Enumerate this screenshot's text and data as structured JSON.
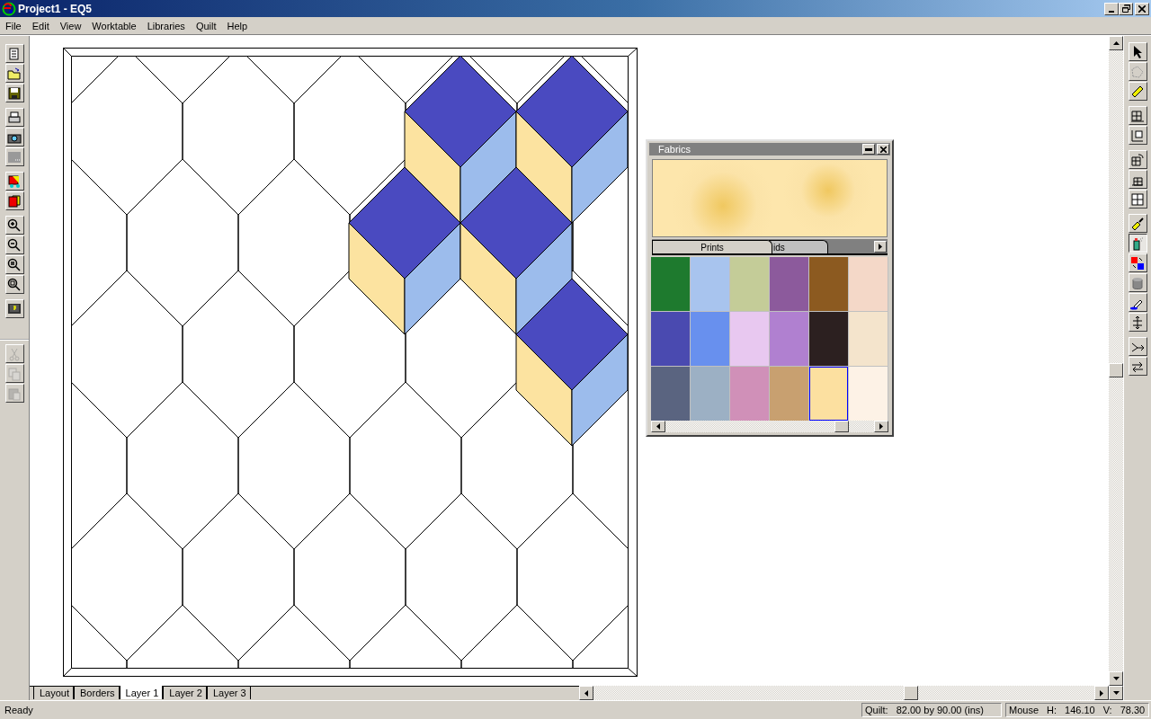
{
  "window": {
    "title": "Project1 - EQ5"
  },
  "menu": [
    "File",
    "Edit",
    "View",
    "Worktable",
    "Libraries",
    "Quilt",
    "Help"
  ],
  "left_toolbar": [
    {
      "disabled": false
    },
    {
      "disabled": false
    },
    {
      "disabled": false
    },
    {
      "disabled": false
    },
    {
      "disabled": false
    },
    {
      "disabled": false
    },
    {
      "disabled": false
    },
    {
      "disabled": false
    },
    {
      "disabled": false
    },
    {
      "disabled": false
    },
    {
      "disabled": false
    },
    {
      "disabled": false
    },
    {
      "disabled": false
    },
    {
      "disabled": true
    },
    {
      "disabled": true
    },
    {
      "disabled": true
    }
  ],
  "right_toolbar": [
    {
      "selected": false
    },
    {
      "selected": false
    },
    {
      "selected": false
    },
    {
      "selected": false
    },
    {
      "selected": false
    },
    {
      "selected": false
    },
    {
      "selected": false
    },
    {
      "selected": false
    },
    {
      "selected": false
    },
    {
      "selected": true
    },
    {
      "selected": false
    },
    {
      "selected": false
    },
    {
      "selected": false
    },
    {
      "selected": false
    },
    {
      "selected": false
    },
    {
      "selected": false
    }
  ],
  "fabrics_panel": {
    "title": "Fabrics",
    "tabs": [
      {
        "label": "Prints",
        "selected": true
      },
      {
        "label": "ids",
        "selected": false
      }
    ],
    "swatches": [
      {
        "color": "#1e7a2e",
        "selected": false
      },
      {
        "color": "#a8c4ee",
        "selected": false
      },
      {
        "color": "#c4cc98",
        "selected": false
      },
      {
        "color": "#8c5a9c",
        "selected": false
      },
      {
        "color": "#8c5a20",
        "selected": false
      },
      {
        "color": "#f4d8c8",
        "selected": false
      },
      {
        "color": "#4a4ab0",
        "selected": false
      },
      {
        "color": "#6890ee",
        "selected": false
      },
      {
        "color": "#e8c8f0",
        "selected": false
      },
      {
        "color": "#b080d0",
        "selected": false
      },
      {
        "color": "#2c2020",
        "selected": false
      },
      {
        "color": "#f4e4cc",
        "selected": false
      },
      {
        "color": "#5a6480",
        "selected": false
      },
      {
        "color": "#9cb0c4",
        "selected": false
      },
      {
        "color": "#d090b8",
        "selected": false
      },
      {
        "color": "#c8a070",
        "selected": false
      },
      {
        "color": "#fce0a0",
        "selected": true
      },
      {
        "color": "#fdf2e6",
        "selected": false
      }
    ]
  },
  "worktable_tabs": [
    {
      "label": "Layout",
      "selected": false
    },
    {
      "label": "Borders",
      "selected": false
    },
    {
      "label": "Layer 1",
      "selected": true
    },
    {
      "label": "Layer 2",
      "selected": false
    },
    {
      "label": "Layer 3",
      "selected": false
    }
  ],
  "status_bar": {
    "message": "Ready",
    "quilt_label": "Quilt:",
    "quilt_size": "82.00 by 90.00 (ins)",
    "mouse_label": "Mouse",
    "h_label": "H:",
    "h_value": "146.10",
    "v_label": "V:",
    "v_value": "78.30"
  }
}
